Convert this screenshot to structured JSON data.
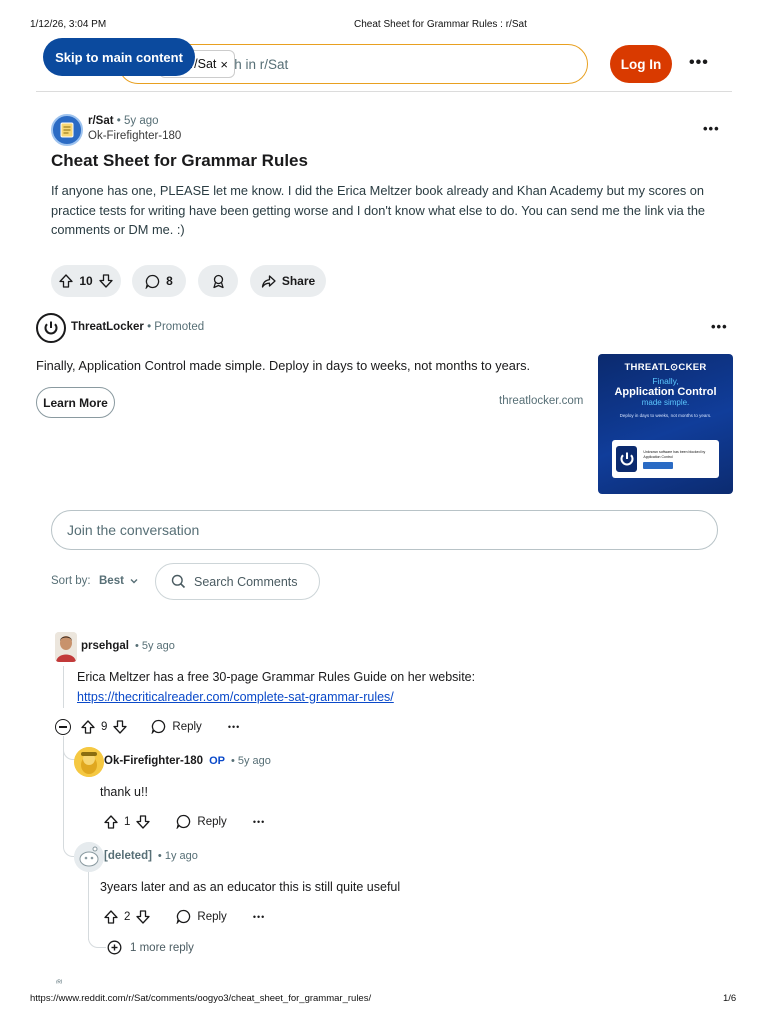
{
  "print": {
    "datetime": "1/12/26, 3:04 PM",
    "doc_title": "Cheat Sheet for Grammar Rules : r/Sat",
    "url": "https://www.reddit.com/r/Sat/comments/oogyo3/cheat_sheet_for_grammar_rules/",
    "page": "1/6",
    "page_bottom_fragment": "ʳᴿᴵ"
  },
  "header": {
    "skip_link": "Skip to main content",
    "search_chip": "r/Sat",
    "search_chip_close": "×",
    "search_placeholder": "Search in r/Sat",
    "login": "Log In",
    "more": "•••"
  },
  "post": {
    "subreddit": "r/Sat",
    "age": "• 5y ago",
    "author": "Ok-Firefighter-180",
    "title": "Cheat Sheet for Grammar Rules",
    "body": "If anyone has one, PLEASE let me know. I did the Erica Meltzer book already and Khan Academy but my scores on practice tests for writing have been getting worse and I don't know what else to do. You can send me the link via the comments or DM me. :)",
    "votes": "10",
    "comments": "8",
    "share": "Share",
    "more": "•••"
  },
  "ad": {
    "advertiser": "ThreatLocker",
    "promoted": "• Promoted",
    "text": "Finally, Application Control made simple. Deploy in days to weeks, not months to years.",
    "cta": "Learn More",
    "domain": "threatlocker.com",
    "more": "•••",
    "image": {
      "brand": "THREATL⊙CKER",
      "line1": "Finally,",
      "line2": "Application Control",
      "line3": "made simple.",
      "line4": "Deploy in days to weeks, not months to years.",
      "card_text": "Unknown software has been blocked by Application Control",
      "card_button": "Request Access"
    },
    "colors": {
      "bg": "#0b2a6e",
      "accent": "#5cc8ff"
    }
  },
  "conversation": {
    "join_placeholder": "Join the conversation",
    "sort_label": "Sort by:",
    "sort_value": "Best",
    "search_comments": "Search Comments"
  },
  "comments": [
    {
      "user": "prsehgal",
      "age": "• 5y ago",
      "text": "Erica Meltzer has a free 30-page Grammar Rules Guide on her website:",
      "link": "https://thecriticalreader.com/complete-sat-grammar-rules/",
      "votes": "9",
      "reply": "Reply",
      "more": "•••"
    },
    {
      "user": "Ok-Firefighter-180",
      "op": "OP",
      "age": "• 5y ago",
      "text": "thank u!!",
      "votes": "1",
      "reply": "Reply",
      "more": "•••"
    },
    {
      "user": "[deleted]",
      "age": "• 1y ago",
      "text": "3years later and as an educator this is still quite useful",
      "votes": "2",
      "reply": "Reply",
      "more": "•••"
    }
  ],
  "more_replies": "1 more reply",
  "colors": {
    "login": "#d93a00",
    "skip": "#0b4a9e",
    "search_border": "#e8a020",
    "link": "#0a49c9",
    "pill_bg": "#eaedef"
  }
}
